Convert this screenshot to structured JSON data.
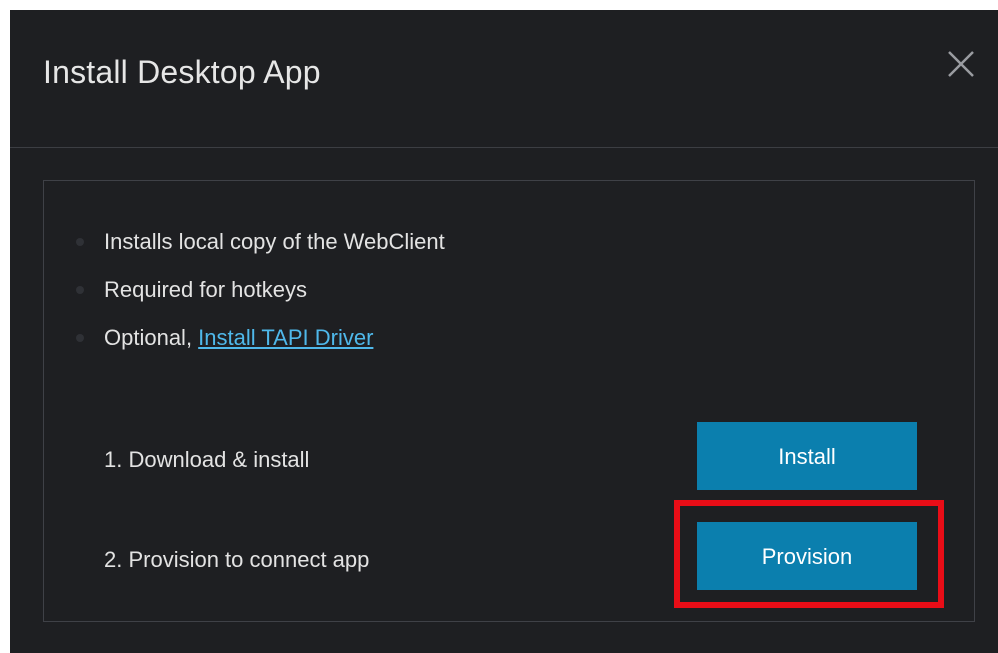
{
  "dialog": {
    "title": "Install Desktop App",
    "close_icon": "close-icon"
  },
  "features": [
    {
      "text": "Installs local copy of the WebClient"
    },
    {
      "text": "Required for hotkeys"
    },
    {
      "prefix": "Optional, ",
      "link": "Install TAPI Driver"
    }
  ],
  "steps": [
    {
      "label": "1. Download & install",
      "button": "Install"
    },
    {
      "label": "2. Provision to connect app",
      "button": "Provision"
    }
  ],
  "colors": {
    "dialog_bg": "#1e1f22",
    "button_bg": "#0b7fae",
    "link": "#4fb8ea",
    "highlight": "#e80d17"
  }
}
